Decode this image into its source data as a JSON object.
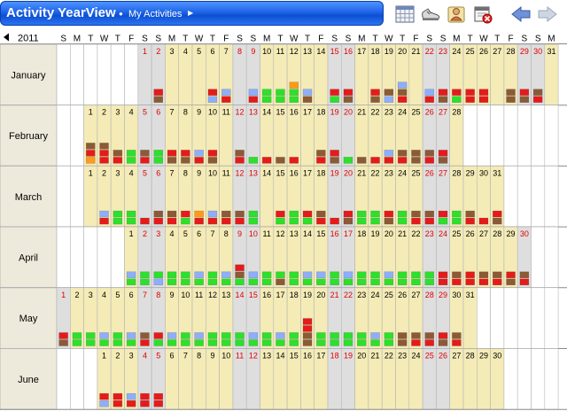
{
  "header": {
    "app_title": "Activity YearView",
    "breadcrumb": "My Activities",
    "toolbar_icons": [
      "calendar-grid-icon",
      "sneaker-icon",
      "user-card-icon",
      "delete-calendar-icon",
      "back-arrow-icon",
      "forward-arrow-icon"
    ]
  },
  "calendar": {
    "year": "2011",
    "weekday_letters": [
      "S",
      "M",
      "T",
      "W",
      "T",
      "F",
      "S"
    ],
    "months": [
      "January",
      "February",
      "March",
      "April",
      "May",
      "June"
    ],
    "month_start_dow": [
      6,
      2,
      2,
      5,
      0,
      3
    ],
    "month_lengths": [
      31,
      28,
      31,
      30,
      31,
      30
    ],
    "colors": {
      "month_bg": "#f4ebb6",
      "weekend_bg": "#dedede",
      "label_bg": "#eeeadb",
      "weekend_text": "#e00000",
      "grid_line": "#b5b5b5",
      "activity": {
        "R": "#e51b1b",
        "B": "#8c5a36",
        "L": "#8eaefc",
        "G": "#2ce02c",
        "O": "#ff9a1a"
      }
    },
    "activities": {
      "January": {
        "2": "RB",
        "6": "RL",
        "7": "LR",
        "9": "LR",
        "10": "GG",
        "11": "GG",
        "12": "OGG",
        "13": "LB",
        "15": "RG",
        "16": "RB",
        "18": "RB",
        "19": "BL",
        "20": "LBR",
        "22": "LR",
        "23": "RB",
        "24": "RG",
        "25": "RR",
        "26": "RR",
        "28": "BB",
        "29": "RB",
        "30": "BR"
      },
      "February": {
        "1": "BRO",
        "2": "BRR",
        "3": "BR",
        "4": "GG",
        "5": "BR",
        "6": "GG",
        "7": "RB",
        "8": "RB",
        "9": "LR",
        "10": "RB",
        "12": "BR",
        "13": "G",
        "14": "R",
        "15": "B",
        "16": "R",
        "18": "BR",
        "19": "RB",
        "20": "G",
        "21": "B",
        "22": "R",
        "23": "LR",
        "24": "BR",
        "25": "BB",
        "26": "BR",
        "27": "RB"
      },
      "March": {
        "2": "LR",
        "3": "GG",
        "4": "GG",
        "5": "R",
        "6": "BR",
        "7": "BR",
        "8": "RG",
        "9": "OR",
        "10": "LR",
        "11": "BR",
        "12": "BR",
        "13": "GG",
        "15": "RG",
        "16": "GG",
        "17": "RG",
        "18": "BR",
        "19": "R",
        "20": "RB",
        "21": "GG",
        "22": "GG",
        "23": "RB",
        "24": "GG",
        "25": "BR",
        "26": "BR",
        "27": "RG",
        "28": "GG",
        "29": "BR",
        "30": "R",
        "31": "RB"
      },
      "April": {
        "1": "LG",
        "2": "GG",
        "3": "GL",
        "4": "GG",
        "5": "GG",
        "6": "LG",
        "7": "GG",
        "8": "LG",
        "9": "RBG",
        "10": "LG",
        "11": "GG",
        "12": "GB",
        "13": "GG",
        "14": "LG",
        "15": "LG",
        "16": "GG",
        "17": "LG",
        "18": "GG",
        "19": "GG",
        "20": "LG",
        "21": "GG",
        "22": "GG",
        "23": "GG",
        "24": "RR",
        "25": "BR",
        "26": "RR",
        "27": "BR",
        "28": "BR",
        "29": "RB",
        "30": "BR"
      },
      "May": {
        "1": "RB",
        "2": "GG",
        "3": "GG",
        "4": "LG",
        "5": "GG",
        "6": "LG",
        "7": "BR",
        "8": "RG",
        "9": "LG",
        "10": "GG",
        "11": "LG",
        "12": "GG",
        "13": "GG",
        "14": "GG",
        "15": "LG",
        "16": "GG",
        "17": "LG",
        "18": "GG",
        "19": "RRBB",
        "20": "GG",
        "21": "GG",
        "22": "GG",
        "23": "GG",
        "24": "LG",
        "25": "GG",
        "26": "BB",
        "27": "BR",
        "28": "BR",
        "29": "RB",
        "30": "BR"
      },
      "June": {
        "1": "RL",
        "2": "RR",
        "3": "LR",
        "4": "RR",
        "5": "RR"
      }
    }
  }
}
